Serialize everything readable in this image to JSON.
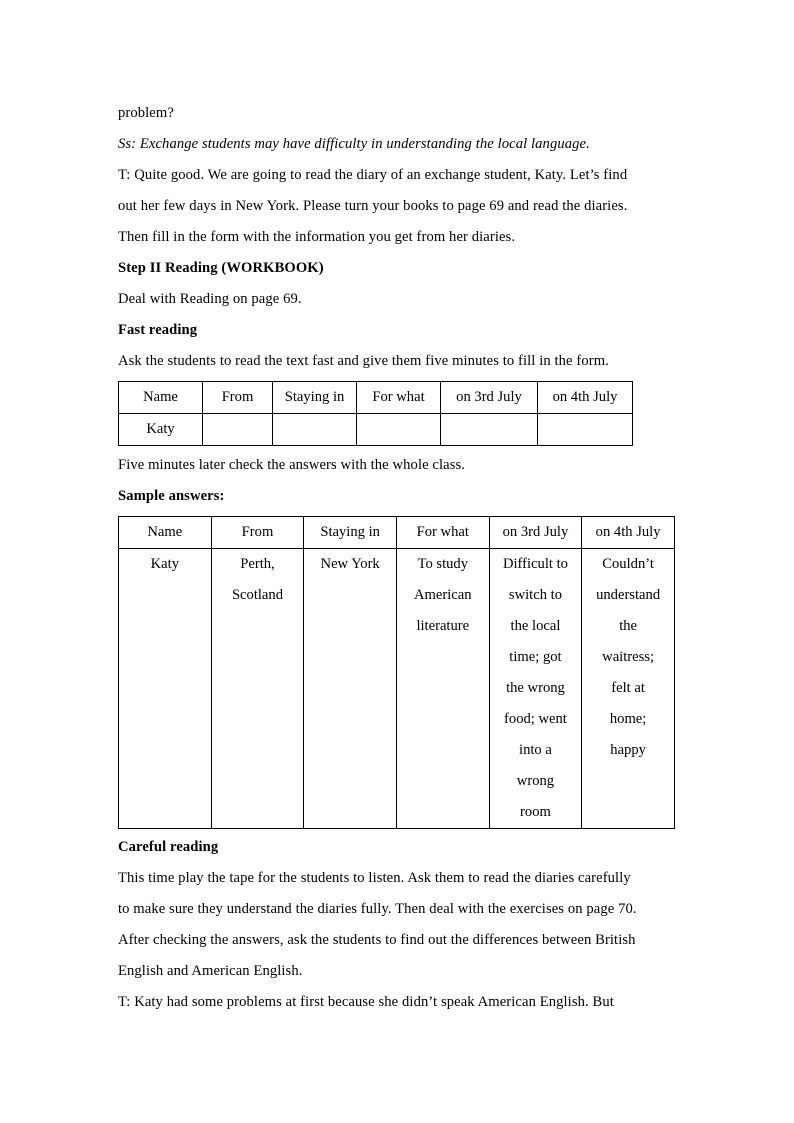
{
  "document": {
    "paragraphs_top": [
      {
        "id": "p1",
        "text": "problem?",
        "style": "normal"
      },
      {
        "id": "p2",
        "text": "Ss: Exchange students may have difficulty in understanding the local language.",
        "style": "italic"
      },
      {
        "id": "p3",
        "text": "T: Quite good. We are going to read the diary of an exchange student, Katy. Let’s find",
        "style": "normal"
      },
      {
        "id": "p4",
        "text": "out her few days in New York. Please turn your books to page 69 and read the diaries.",
        "style": "normal"
      },
      {
        "id": "p5",
        "text": "Then fill in the form with the information you get from her diaries.",
        "style": "normal"
      }
    ],
    "heading_step2": "Step II Reading (WORKBOOK)",
    "line_deal_with": "Deal with Reading on page 69.",
    "heading_fast_reading": "Fast reading",
    "line_ask_students": "Ask the students to read the text fast and give them five minutes to fill in the form.",
    "line_five_minutes": "Five minutes later check the answers with the whole class.",
    "heading_sample_answers": "Sample answers:",
    "heading_careful_reading": "Careful reading",
    "paragraphs_bottom": [
      {
        "id": "b1",
        "text": "This time play the tape for the students to listen. Ask them to read the diaries carefully",
        "style": "normal"
      },
      {
        "id": "b2",
        "text": "to make sure they understand the diaries fully. Then deal with the exercises on page 70.",
        "style": "normal"
      },
      {
        "id": "b3",
        "text": "After checking the answers, ask the students to find out the differences between British",
        "style": "normal"
      },
      {
        "id": "b4",
        "text": "English and American English.",
        "style": "normal"
      },
      {
        "id": "b5",
        "text": "T: Katy had some problems at first because she didn’t speak American English. But",
        "style": "normal"
      }
    ]
  },
  "form_table": {
    "headers": [
      "Name",
      "From",
      "Staying in",
      "For what",
      "on 3rd July",
      "on 4th July"
    ],
    "rows": [
      [
        "Katy",
        "",
        "",
        "",
        "",
        ""
      ]
    ]
  },
  "answers_table": {
    "headers": [
      "Name",
      "From",
      "Staying in",
      "For what",
      "on 3rd July",
      "on 4th July"
    ],
    "rows": [
      [
        {
          "lines": [
            "Katy"
          ]
        },
        {
          "lines": [
            "Perth,",
            "Scotland"
          ]
        },
        {
          "lines": [
            "New York"
          ]
        },
        {
          "lines": [
            "To study",
            "American",
            "literature"
          ]
        },
        {
          "lines": [
            "Difficult to",
            "switch to",
            "the local",
            "time; got",
            "the wrong",
            "food; went",
            "into a",
            "wrong",
            "room"
          ]
        },
        {
          "lines": [
            "Couldn’t",
            "understand",
            "the",
            "waitress;",
            "felt at",
            "home;",
            "happy"
          ]
        }
      ]
    ]
  }
}
